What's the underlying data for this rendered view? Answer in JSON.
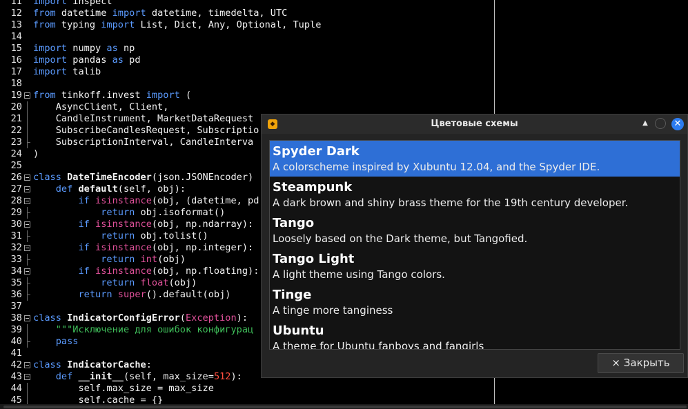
{
  "editor": {
    "lines": [
      {
        "n": "11",
        "fold": "",
        "html": "<span class=\"kw\">import</span> inspect"
      },
      {
        "n": "12",
        "fold": "",
        "html": "<span class=\"kw\">from</span> datetime <span class=\"kw\">import</span> datetime, timedelta, UTC"
      },
      {
        "n": "13",
        "fold": "",
        "html": "<span class=\"kw\">from</span> typing <span class=\"kw\">import</span> List, Dict, Any, Optional, Tuple"
      },
      {
        "n": "14",
        "fold": "",
        "html": ""
      },
      {
        "n": "15",
        "fold": "",
        "html": "<span class=\"kw\">import</span> numpy <span class=\"kw\">as</span> np"
      },
      {
        "n": "16",
        "fold": "",
        "html": "<span class=\"kw\">import</span> pandas <span class=\"kw\">as</span> pd"
      },
      {
        "n": "17",
        "fold": "",
        "html": "<span class=\"kw\">import</span> talib"
      },
      {
        "n": "18",
        "fold": "",
        "html": ""
      },
      {
        "n": "19",
        "fold": "box",
        "html": "<span class=\"kw\">from</span> tinkoff.invest <span class=\"kw\">import</span> ("
      },
      {
        "n": "20",
        "fold": "tick",
        "html": "    AsyncClient, Client,"
      },
      {
        "n": "21",
        "fold": "tick",
        "html": "    CandleInstrument, MarketDataRequest"
      },
      {
        "n": "22",
        "fold": "tick",
        "html": "    SubscribeCandlesRequest, Subscriptio"
      },
      {
        "n": "23",
        "fold": "end",
        "html": "    SubscriptionInterval, CandleInterva"
      },
      {
        "n": "24",
        "fold": "",
        "html": ")"
      },
      {
        "n": "25",
        "fold": "",
        "html": ""
      },
      {
        "n": "26",
        "fold": "box",
        "html": "<span class=\"kw\">class</span> <span class=\"fn\">DateTimeEncoder</span>(json.JSONEncoder)"
      },
      {
        "n": "27",
        "fold": "box",
        "html": "    <span class=\"kw\">def</span> <span class=\"fn\">default</span>(self, obj):"
      },
      {
        "n": "28",
        "fold": "box",
        "html": "        <span class=\"kw\">if</span> <span class=\"bi\">isinstance</span>(obj, (datetime, pd"
      },
      {
        "n": "29",
        "fold": "end",
        "html": "            <span class=\"kw\">return</span> obj.isoformat()"
      },
      {
        "n": "30",
        "fold": "box",
        "html": "        <span class=\"kw\">if</span> <span class=\"bi\">isinstance</span>(obj, np.ndarray):"
      },
      {
        "n": "31",
        "fold": "end",
        "html": "            <span class=\"kw\">return</span> obj.tolist()"
      },
      {
        "n": "32",
        "fold": "box",
        "html": "        <span class=\"kw\">if</span> <span class=\"bi\">isinstance</span>(obj, np.integer):"
      },
      {
        "n": "33",
        "fold": "end",
        "html": "            <span class=\"kw\">return</span> <span class=\"bi\">int</span>(obj)"
      },
      {
        "n": "34",
        "fold": "box",
        "html": "        <span class=\"kw\">if</span> <span class=\"bi\">isinstance</span>(obj, np.floating):"
      },
      {
        "n": "35",
        "fold": "end",
        "html": "            <span class=\"kw\">return</span> <span class=\"bi\">float</span>(obj)"
      },
      {
        "n": "36",
        "fold": "end",
        "html": "        <span class=\"kw\">return</span> <span class=\"bi\">super</span>().default(obj)"
      },
      {
        "n": "37",
        "fold": "",
        "html": ""
      },
      {
        "n": "38",
        "fold": "box",
        "html": "<span class=\"kw\">class</span> <span class=\"fn\">IndicatorConfigError</span>(<span class=\"bi\">Exception</span>):"
      },
      {
        "n": "39",
        "fold": "tick",
        "html": "    <span class=\"str\">\"\"\"Исключение для ошибок конфигурац</span>"
      },
      {
        "n": "40",
        "fold": "end",
        "html": "    <span class=\"kw\">pass</span>"
      },
      {
        "n": "41",
        "fold": "",
        "html": ""
      },
      {
        "n": "42",
        "fold": "box",
        "html": "<span class=\"kw\">class</span> <span class=\"fn\">IndicatorCache</span>:"
      },
      {
        "n": "43",
        "fold": "box",
        "html": "    <span class=\"kw\">def</span> <span class=\"fn\">__init__</span>(self, max_size=<span class=\"num\">512</span>):"
      },
      {
        "n": "44",
        "fold": "tick",
        "html": "        self.max_size = max_size"
      },
      {
        "n": "45",
        "fold": "tick",
        "html": "        self.cache = {}"
      }
    ]
  },
  "dialog": {
    "title": "Цветовые схемы",
    "app_icon": "app-icon",
    "close_label": "× Закрыть",
    "accent_color": "#2e6fd6",
    "schemes": [
      {
        "name": "Spyder Dark",
        "description": "A colorscheme inspired by Xubuntu 12.04, and the Spyder IDE.",
        "selected": true
      },
      {
        "name": "Steampunk",
        "description": "A dark brown and shiny brass theme for the 19th century developer.",
        "selected": false
      },
      {
        "name": "Tango",
        "description": "Loosely based on the Dark theme, but Tangofied.",
        "selected": false
      },
      {
        "name": "Tango Light",
        "description": "A light theme using Tango colors.",
        "selected": false
      },
      {
        "name": "Tinge",
        "description": "A tinge more tanginess",
        "selected": false
      },
      {
        "name": "Ubuntu",
        "description": "A theme for Ubuntu fanboys and fangirls",
        "selected": false
      }
    ]
  }
}
